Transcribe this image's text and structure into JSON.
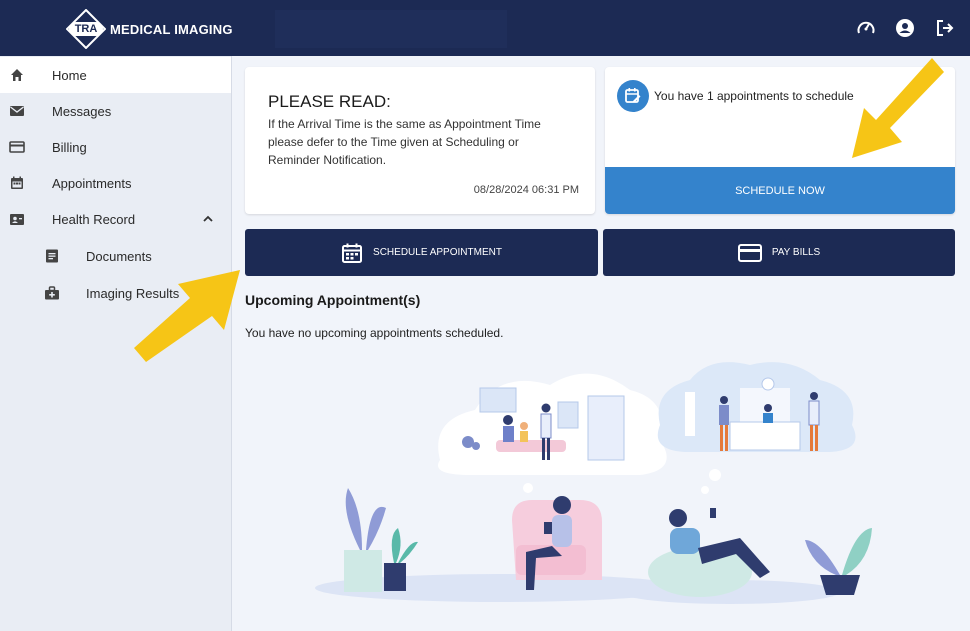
{
  "header": {
    "logo_mark": "TRA",
    "logo_text": "MEDICAL IMAGING"
  },
  "icons": {
    "speedometer": "speedometer-icon",
    "account": "account-icon",
    "logout": "logout-icon"
  },
  "sidebar": {
    "items": [
      {
        "label": "Home",
        "icon": "home-icon"
      },
      {
        "label": "Messages",
        "icon": "mail-icon"
      },
      {
        "label": "Billing",
        "icon": "credit-card-icon"
      },
      {
        "label": "Appointments",
        "icon": "calendar-icon"
      },
      {
        "label": "Health Record",
        "icon": "health-record-icon"
      },
      {
        "label": "Documents",
        "icon": "document-icon"
      },
      {
        "label": "Imaging Results",
        "icon": "medical-bag-icon"
      }
    ]
  },
  "notice": {
    "title": "PLEASE READ:",
    "body": "If the Arrival Time is the same as Appointment Time please defer to the Time given at Scheduling or Reminder Notification.",
    "date": "08/28/2024 06:31 PM"
  },
  "appointments_card": {
    "message": "You have 1 appointments to schedule",
    "button": "SCHEDULE NOW"
  },
  "actions": {
    "schedule": "SCHEDULE APPOINTMENT",
    "pay": "PAY BILLS"
  },
  "upcoming": {
    "title": "Upcoming Appointment(s)",
    "empty": "You have no upcoming appointments scheduled."
  },
  "colors": {
    "navy": "#1c2a54",
    "blue": "#3483cc",
    "arrow": "#f6c516"
  }
}
